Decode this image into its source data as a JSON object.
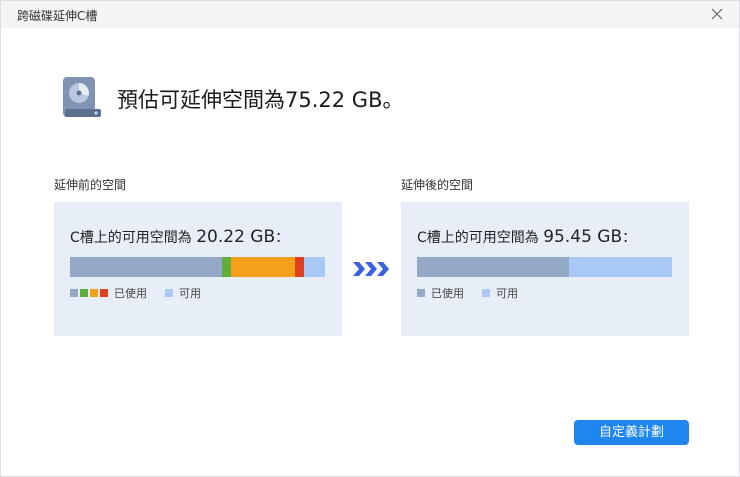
{
  "window": {
    "title": "跨磁碟延伸C槽"
  },
  "hero": {
    "text": "預估可延伸空間為75.22 GB。"
  },
  "before": {
    "label": "延伸前的空間",
    "prefix": "C槽上的可用空間為 ",
    "value": "20.22 GB",
    "suffix": "：",
    "segments": [
      {
        "color": "#93a9c6",
        "fraction": 0.598
      },
      {
        "color": "#5fad3a",
        "fraction": 0.035
      },
      {
        "color": "#f5a01a",
        "fraction": 0.25
      },
      {
        "color": "#e0401c",
        "fraction": 0.035
      },
      {
        "color": "#aac8f5",
        "fraction": 0.082
      }
    ],
    "legend": {
      "used_label": "已使用",
      "used_colors": [
        "#93a9c6",
        "#5fad3a",
        "#f5a01a",
        "#e0401c"
      ],
      "free_label": "可用",
      "free_color": "#aac8f5"
    }
  },
  "after": {
    "label": "延伸後的空間",
    "prefix": "C槽上的可用空間為 ",
    "value": "95.45 GB",
    "suffix": "：",
    "segments": [
      {
        "color": "#93a9c6",
        "fraction": 0.597
      },
      {
        "color": "#aac8f5",
        "fraction": 0.403
      }
    ],
    "legend": {
      "used_label": "已使用",
      "used_colors": [
        "#93a9c6"
      ],
      "free_label": "可用",
      "free_color": "#aac8f5"
    }
  },
  "button": {
    "label": "自定義計劃"
  },
  "colors": {
    "accent": "#1f86f0",
    "arrow": "#3a62e0",
    "panel": "#e8eef8"
  }
}
